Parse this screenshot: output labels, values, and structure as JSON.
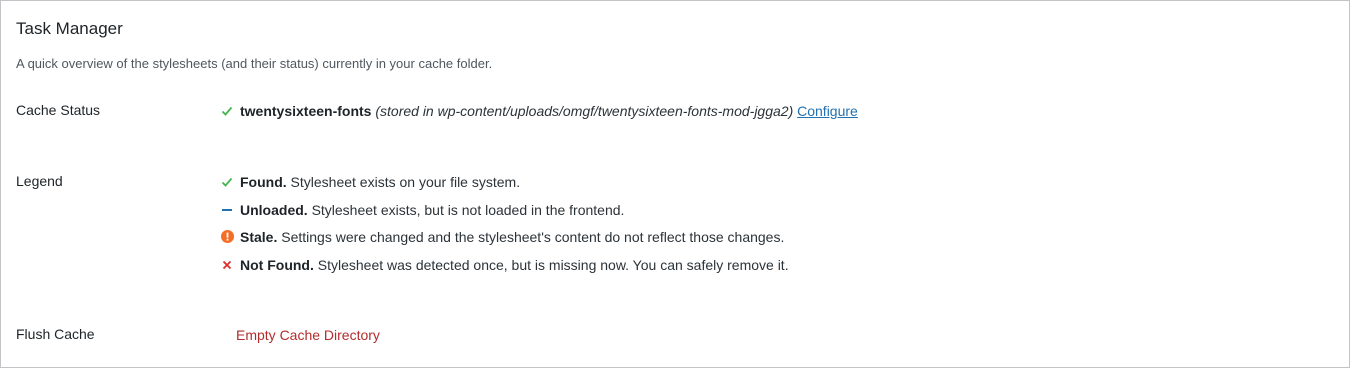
{
  "header": {
    "title": "Task Manager",
    "description": "A quick overview of the stylesheets (and their status) currently in your cache folder."
  },
  "cache_status": {
    "label": "Cache Status",
    "item_name": "twentysixteen-fonts",
    "item_path": "(stored in wp-content/uploads/omgf/twentysixteen-fonts-mod-jgga2)",
    "configure_link": "Configure",
    "status_icon": "check-icon"
  },
  "legend": {
    "label": "Legend",
    "items": [
      {
        "icon": "check-icon",
        "term": "Found.",
        "text": "Stylesheet exists on your file system."
      },
      {
        "icon": "dash-icon",
        "term": "Unloaded.",
        "text": "Stylesheet exists, but is not loaded in the frontend."
      },
      {
        "icon": "warning-icon",
        "term": "Stale.",
        "text": "Settings were changed and the stylesheet's content do not reflect those changes."
      },
      {
        "icon": "cross-icon",
        "term": "Not Found.",
        "text": "Stylesheet was detected once, but is missing now. You can safely remove it."
      }
    ]
  },
  "flush": {
    "label": "Flush Cache",
    "button": "Empty Cache Directory"
  },
  "colors": {
    "success": "#46b450",
    "info": "#2271b1",
    "warning": "#f56e28",
    "error": "#dc3232",
    "link": "#2271b1",
    "danger_text": "#b32d2e"
  }
}
